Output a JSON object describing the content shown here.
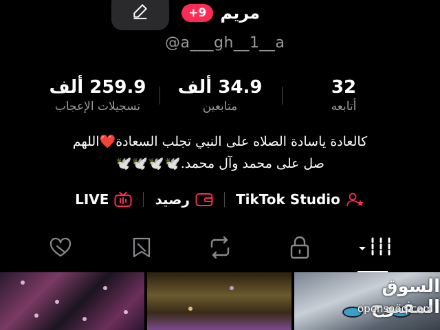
{
  "header": {
    "name": "مريم",
    "badge": "+9",
    "username": "@a___gh__1__a"
  },
  "stats": [
    {
      "value": "32",
      "label": "أتابعه"
    },
    {
      "value": "34.9 ألف",
      "label": "متابعين"
    },
    {
      "value": "259.9 ألف",
      "label": "تسجيلات الإعجاب"
    }
  ],
  "bio": {
    "line1": "كالعادة ياسادة الصلاه على النبي تجلب السعادة❤️اللهم",
    "line2": "صل على محمد وآل محمد.🕊️🕊️🕊️🕊️"
  },
  "links": {
    "studio": "TikTok Studio",
    "balance": "رصيد",
    "live": "LIVE"
  },
  "watermark": {
    "main": "السوق المفتوح",
    "sub": "opensooq.com"
  },
  "colors": {
    "accent": "#fe2c55",
    "background": "#000000",
    "muted": "#9a9a9e"
  }
}
